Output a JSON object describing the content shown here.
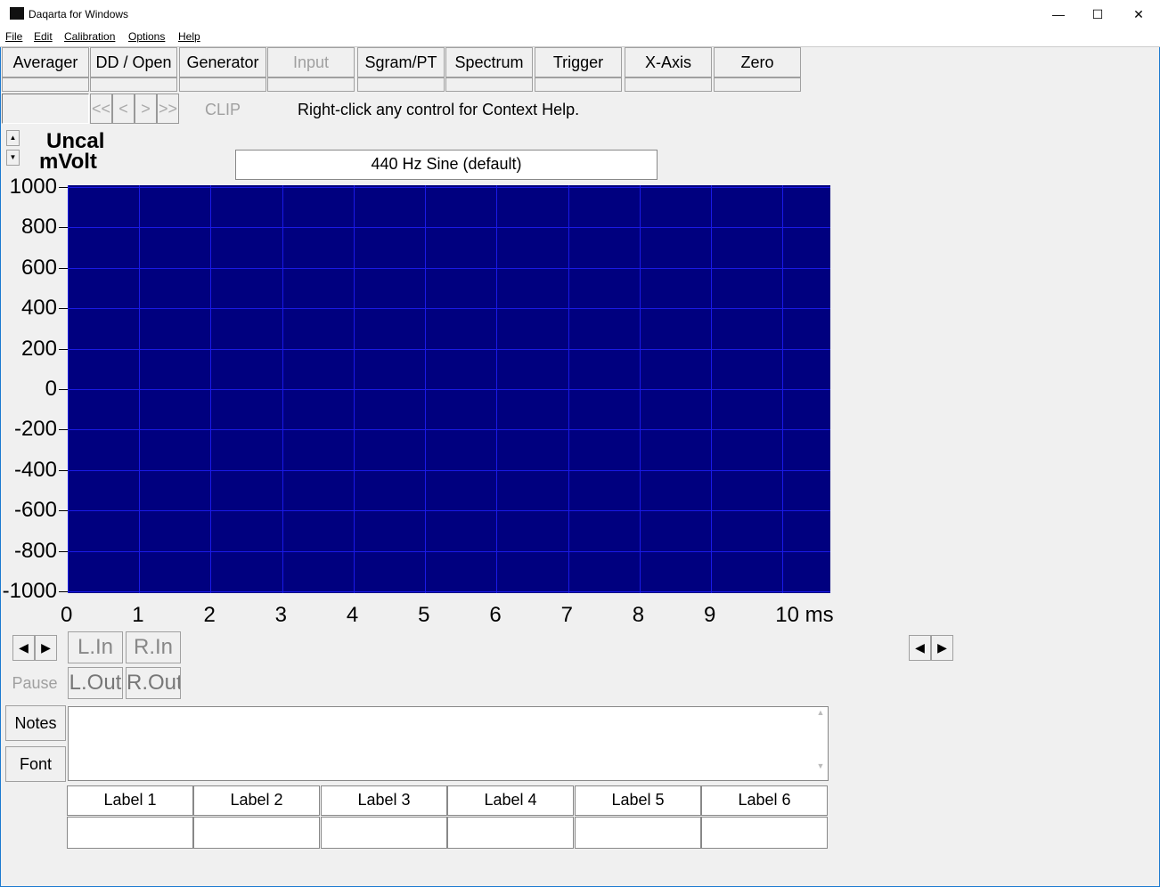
{
  "window": {
    "title": "Daqarta for Windows",
    "minimize": "—",
    "maximize": "☐",
    "close": "✕"
  },
  "menu": [
    "File",
    "Edit",
    "Calibration",
    "Options",
    "Help"
  ],
  "tabs": [
    {
      "label": "Averager",
      "enabled": true
    },
    {
      "label": "DD / Open",
      "enabled": true
    },
    {
      "label": "Generator",
      "enabled": true
    },
    {
      "label": "Input",
      "enabled": false
    },
    {
      "label": "Sgram/PT",
      "enabled": true
    },
    {
      "label": "Spectrum",
      "enabled": true
    },
    {
      "label": "Trigger",
      "enabled": true
    },
    {
      "label": "X-Axis",
      "enabled": true
    },
    {
      "label": "Zero",
      "enabled": true
    }
  ],
  "nav": [
    "<<",
    "<",
    ">",
    ">>"
  ],
  "clip": "CLIP",
  "help_text": "Right-click any control for Context Help.",
  "y_units": {
    "line1": "Uncal",
    "line2": "mVolt"
  },
  "generator_label": "440 Hz Sine (default)",
  "chart_data": {
    "type": "line",
    "x_ticks": [
      "0",
      "1",
      "2",
      "3",
      "4",
      "5",
      "6",
      "7",
      "8",
      "9",
      "10 ms"
    ],
    "y_ticks": [
      "1000",
      "800",
      "600",
      "400",
      "200",
      "0",
      "-200",
      "-400",
      "-600",
      "-800",
      "-1000"
    ],
    "xlim": [
      0,
      10.67
    ],
    "ylim": [
      -1000,
      1000
    ],
    "xlabel": "ms",
    "ylabel": "mVolt",
    "grid": true,
    "background": "#00007f",
    "grid_color": "#1a1ae6",
    "series": []
  },
  "channels": {
    "l_in": "L.In",
    "r_in": "R.In",
    "l_out": "L.Out",
    "r_out": "R.Out",
    "pause": "Pause"
  },
  "notes_button": "Notes",
  "font_button": "Font",
  "notes_text": "",
  "labels": [
    "Label 1",
    "Label 2",
    "Label 3",
    "Label 4",
    "Label 5",
    "Label 6"
  ],
  "label_values": [
    "",
    "",
    "",
    "",
    "",
    ""
  ]
}
